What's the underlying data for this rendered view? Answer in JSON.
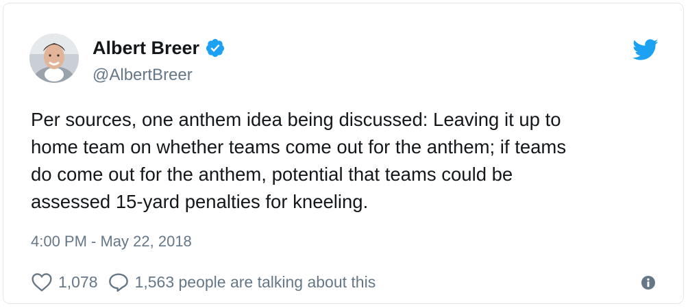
{
  "author": {
    "name": "Albert Breer",
    "handle": "@AlbertBreer",
    "verified": true,
    "avatar": "profile-photo"
  },
  "tweet": {
    "text_lines": [
      "Per sources, one anthem idea being discussed: Leaving it up to",
      "home team on whether teams come out for the anthem; if teams",
      "do come out for the anthem, potential that teams could be",
      "assessed 15-yard penalties for kneeling."
    ],
    "timestamp": "4:00 PM - May 22, 2018"
  },
  "engagement": {
    "likes": "1,078",
    "talking": "1,563 people are talking about this"
  },
  "icons": {
    "bird": "twitter-bird-icon",
    "verified": "verified-badge-icon",
    "like": "heart-icon",
    "reply": "reply-icon",
    "info": "info-icon"
  },
  "colors": {
    "brand": "#1da1f2",
    "text": "#14171a",
    "secondary": "#657786",
    "border": "#e1e8ed"
  }
}
